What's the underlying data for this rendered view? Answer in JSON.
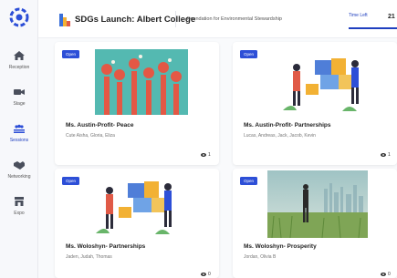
{
  "sidebar": {
    "items": [
      {
        "label": "Reception",
        "icon": "home-icon"
      },
      {
        "label": "Stage",
        "icon": "video-camera-icon"
      },
      {
        "label": "Sessions",
        "icon": "group-icon"
      },
      {
        "label": "Networking",
        "icon": "handshake-icon"
      },
      {
        "label": "Expo",
        "icon": "store-icon"
      }
    ],
    "active_index": 2
  },
  "header": {
    "title": "SDGs Launch: Albert College",
    "organization": "Foundation for Environmental Stewardship",
    "time_left_label": "Time Left",
    "time_left_value": "21"
  },
  "sessions": [
    {
      "status": "Open",
      "name": "Ms. Austin-Profit- Peace",
      "people": "Cute Aisha, Gloria, Eliza",
      "views": "1",
      "image": "raised-hands-illustration"
    },
    {
      "status": "Open",
      "name": "Ms. Austin-Profit- Partnerships",
      "people": "Lucas, Andreas, Jack, Jacob, Kevin",
      "views": "1",
      "image": "puzzle-partnership-illustration"
    },
    {
      "status": "Open",
      "name": "Ms. Woloshyn- Partnerships",
      "people": "Jaden, Judah, Thomas",
      "views": "0",
      "image": "puzzle-partnership-illustration"
    },
    {
      "status": "Open",
      "name": "Ms. Woloshyn- Prosperity",
      "people": "Jordan, Olivia B",
      "views": "0",
      "image": "field-city-photo"
    }
  ],
  "colors": {
    "accent": "#2d4fd7",
    "sidebar_bg": "#f7f8fb",
    "hands_bg": "#54b9b1"
  }
}
